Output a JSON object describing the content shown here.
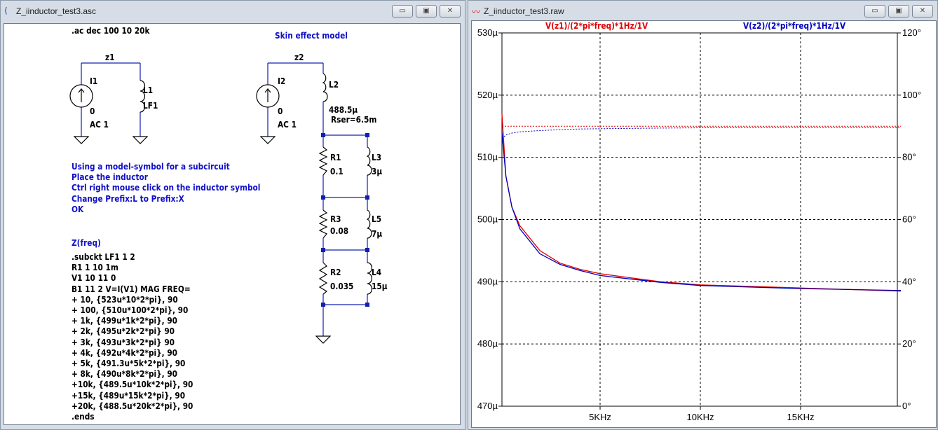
{
  "schematic_window": {
    "title": "Z_iinductor_test3.asc",
    "directive": ".ac dec 100 10 20k",
    "note_title": "Skin effect model",
    "left": {
      "net": "z1",
      "source": "I1",
      "source_val": "0",
      "source_ac": "AC 1",
      "ind": "L1",
      "ind_val": "LF1"
    },
    "right": {
      "net": "z2",
      "source": "I2",
      "source_val": "0",
      "source_ac": "AC 1",
      "ind": "L2",
      "ind_val": "488.5µ",
      "ind_rser": "Rser=6.5m",
      "R1": "R1",
      "R1v": "0.1",
      "L3": "L3",
      "L3v": "3µ",
      "R3": "R3",
      "R3v": "0.08",
      "L5": "L5",
      "L5v": "7µ",
      "R2": "R2",
      "R2v": "0.035",
      "L4": "L4",
      "L4v": "15µ"
    },
    "instructions": [
      "Using a model-symbol for a subcircuit",
      "Place the inductor",
      "Ctrl right mouse click on the inductor symbol",
      "Change Prefix:L to Prefix:X",
      "OK"
    ],
    "netlist_title": "Z(freq)",
    "netlist": [
      ".subckt LF1 1 2",
      "R1 1 10  1m",
      "V1 10 11 0",
      "B1 11 2 V=I(V1)  MAG FREQ=",
      "+ 10, {523u*10*2*pi}, 90",
      "+ 100, {510u*100*2*pi}, 90",
      "+ 1k, {499u*1k*2*pi}, 90",
      "+ 2k, {495u*2k*2*pi} 90",
      "+ 3k, {493u*3k*2*pi} 90",
      "+ 4k, {492u*4k*2*pi}, 90",
      "+ 5k, {491.3u*5k*2*pi}, 90",
      "+ 8k, {490u*8k*2*pi}, 90",
      "+10k, {489.5u*10k*2*pi}, 90",
      "+15k, {489u*15k*2*pi}, 90",
      "+20k, {488.5u*20k*2*pi}, 90",
      ".ends"
    ]
  },
  "plot_window": {
    "title": "Z_iinductor_test3.raw"
  },
  "chart_data": {
    "type": "line",
    "x_unit": "Hz",
    "xlim": [
      0,
      20000
    ],
    "x_ticks": [
      5000,
      10000,
      15000
    ],
    "x_tick_labels": [
      "5KHz",
      "10KHz",
      "15KHz"
    ],
    "ylim": [
      470,
      530
    ],
    "y_ticks": [
      470,
      480,
      490,
      500,
      510,
      520,
      530
    ],
    "y_tick_labels": [
      "470µ",
      "480µ",
      "490µ",
      "500µ",
      "510µ",
      "520µ",
      "530µ"
    ],
    "y2lim": [
      0,
      120
    ],
    "y2_ticks": [
      0,
      20,
      40,
      60,
      80,
      100,
      120
    ],
    "y2_tick_labels": [
      "0°",
      "20°",
      "40°",
      "60°",
      "80°",
      "100°",
      "120°"
    ],
    "grid": true,
    "x": [
      100,
      300,
      600,
      1000,
      2000,
      3000,
      4000,
      5000,
      8000,
      10000,
      15000,
      20000
    ],
    "series": [
      {
        "name": "V(z1)/(2*pi*freq)*1Hz/1V",
        "color": "#e00000",
        "magnitude": [
          517,
          507,
          502,
          499,
          495,
          493,
          492,
          491.3,
          490,
          489.5,
          489,
          488.5
        ],
        "phase": [
          90,
          90,
          90,
          90,
          90,
          90,
          90,
          90,
          90,
          90,
          90,
          90
        ]
      },
      {
        "name": "V(z2)/(2*pi*freq)*1Hz/1V",
        "color": "#0000c0",
        "magnitude": [
          514,
          507,
          502,
          498.5,
          494.5,
          492.8,
          491.8,
          491,
          489.9,
          489.4,
          488.9,
          488.6
        ],
        "phase": [
          86,
          87.2,
          87.8,
          88.2,
          88.6,
          88.9,
          89.1,
          89.2,
          89.4,
          89.5,
          89.6,
          89.6
        ]
      }
    ]
  }
}
